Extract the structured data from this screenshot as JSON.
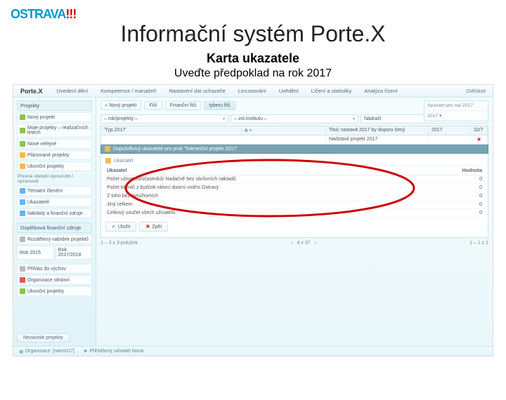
{
  "logo": {
    "part1": "OSTRAVA",
    "excl": "!!!"
  },
  "slide": {
    "title": "Informační systém Porte.X",
    "sub1": "Karta ukazatele",
    "sub2": "Uveďte předpoklad na rok 2017"
  },
  "app": {
    "brand": "Porte.X",
    "topnav": [
      "Uvedení dění",
      "Kompetence / manažeři",
      "Nastavení dat uchazeče",
      "Lincosování",
      "Uvědění",
      "Líčení a statistiky",
      "Analýza řízení"
    ],
    "topright": "Odhlásit"
  },
  "sidebar": {
    "title": "Projekty",
    "items1": [
      "Nový projekt",
      "Moje projekty – realizačních letech",
      "Nové veřejné",
      "Plánované projekty",
      "Ukonční projekty"
    ],
    "note": "Přesné období zprovoztit / opravovat",
    "items2": [
      "Tématní členění",
      "Ukazatelé",
      "Náklady a finanční zdroje"
    ],
    "block3_title": "Doplňková finanční zdroje",
    "items3": [
      "Rozdělený nabídek projektů",
      "Rok 2015",
      "Rok 2017/2018"
    ],
    "items4": [
      "Přihlás do výchov",
      "Organizace obsloví",
      "Ukonční projekty"
    ],
    "bottom_btn": "Nezávislé projekty"
  },
  "statusbar": {
    "a": "Organizace: [námsí17]",
    "b": "Přihlášený uživatel Nová"
  },
  "main": {
    "tabs": [
      "Nový projekt",
      "Fiší",
      "Finanční fiší",
      "tyberu fiší"
    ],
    "filters": {
      "a": "– rok/projekty –",
      "b": "– vol.institutu –",
      "c": "Nádraží"
    },
    "gridh": {
      "a": "'Typ.2017'",
      "b": "A",
      "c": "Titul; nastavit 2017 by doporu čený",
      "d": "2017",
      "e": "32/7"
    },
    "grid_row": {
      "a": "",
      "b": "",
      "c": "Nadstavil projekt 2017",
      "d": "",
      "e": "✖"
    },
    "panel_title": "Dopufuřkový ukazatelé pro prok 'Toleranční projekt 2017'",
    "inner_title": "Ukazatel",
    "table": {
      "head_l": "Ukazatel",
      "head_r": "Hodnota",
      "rows": [
        {
          "l": "Počet uživatelů/účastníků/ Nadačně bez obrůvních nákladů",
          "r": "0"
        },
        {
          "l": "Počet klientů z byd/zlé nktvní doorní vnitřní Ostravy",
          "r": "0"
        },
        {
          "l": "Z toho bez bytu/homích",
          "r": "0"
        },
        {
          "l": "Jiný celkem",
          "r": "0"
        },
        {
          "l": "Celkový součet všech uživatelů",
          "r": "0"
        }
      ]
    },
    "btn_save": "Uložit",
    "btn_cancel": "Zpět",
    "pager_left": "1 – 3 z 3 položek",
    "pager_mid": "4 z 37",
    "pager_right": "1 – 1 z 1"
  },
  "rightbox": {
    "title1": "Seznam pro rok 2017",
    "sep": "",
    "val": "2017 ▾"
  }
}
